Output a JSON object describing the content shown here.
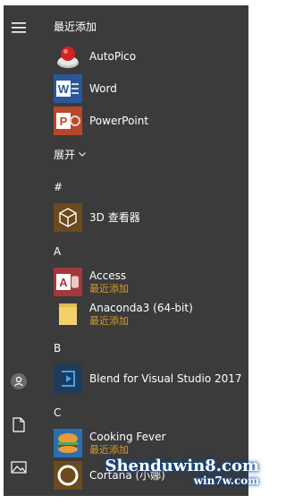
{
  "rail": {
    "menu_icon": "hamburger-menu-icon",
    "user_icon": "user-icon",
    "documents_icon": "document-icon",
    "pictures_icon": "pictures-icon"
  },
  "recent": {
    "header": "最近添加",
    "apps": [
      {
        "name": "AutoPico",
        "icon": "autopico-icon",
        "color": "#3b3b3b"
      },
      {
        "name": "Word",
        "icon": "word-icon",
        "color": "#2b579a"
      },
      {
        "name": "PowerPoint",
        "icon": "powerpoint-icon",
        "color": "#b7472a"
      }
    ]
  },
  "expand_label": "展开",
  "sections": [
    {
      "letter": "#",
      "apps": [
        {
          "name": "3D 查看器",
          "sub": ""
        }
      ]
    },
    {
      "letter": "A",
      "apps": [
        {
          "name": "Access",
          "sub": "最近添加"
        },
        {
          "name": "Anaconda3 (64-bit)",
          "sub": "最近添加"
        }
      ]
    },
    {
      "letter": "B",
      "apps": [
        {
          "name": "Blend for Visual Studio 2017",
          "sub": ""
        }
      ]
    },
    {
      "letter": "C",
      "apps": [
        {
          "name": "Cooking Fever",
          "sub": "最近添加"
        },
        {
          "name": "Cortana (小娜)",
          "sub": ""
        }
      ]
    }
  ],
  "watermark": {
    "line1": "Shenduwin8.com",
    "line2": "win7w.com"
  }
}
